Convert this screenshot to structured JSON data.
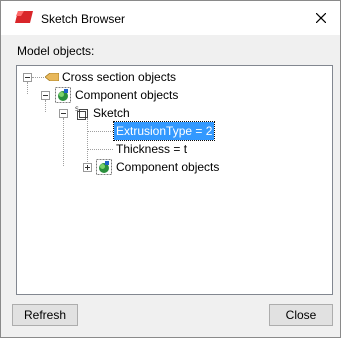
{
  "window": {
    "title": "Sketch Browser"
  },
  "section": {
    "label": "Model objects:"
  },
  "tree": {
    "cross_section": "Cross section objects",
    "component_objects": "Component objects",
    "sketch": "Sketch",
    "extrusion_type": "ExtrusionType = 2",
    "thickness": "Thickness = t",
    "child_component_objects": "Component objects"
  },
  "buttons": {
    "refresh": "Refresh",
    "close": "Close"
  },
  "icons": {
    "app": "sketch-app-icon",
    "close": "close-icon",
    "cross_section": "cross-section-icon",
    "component": "component-icon",
    "sketch": "sketch-icon"
  },
  "colors": {
    "selection": "#3399ff",
    "app_icon": "#d9262a"
  }
}
